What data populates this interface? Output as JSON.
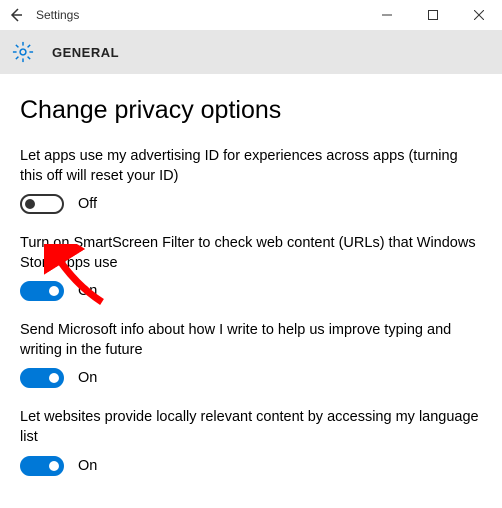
{
  "window": {
    "app_title": "Settings"
  },
  "category": {
    "label": "GENERAL"
  },
  "page": {
    "title": "Change privacy options"
  },
  "settings": [
    {
      "desc": "Let apps use my advertising ID for experiences across apps (turning this off will reset your ID)",
      "state": "off",
      "state_label": "Off"
    },
    {
      "desc": "Turn on SmartScreen Filter to check web content (URLs) that Windows Store apps use",
      "state": "on",
      "state_label": "On"
    },
    {
      "desc": "Send Microsoft info about how I write to help us improve typing and writing in the future",
      "state": "on",
      "state_label": "On"
    },
    {
      "desc": "Let websites provide locally relevant content by accessing my language list",
      "state": "on",
      "state_label": "On"
    }
  ],
  "annotation": {
    "arrow_target": "advertising-id-toggle",
    "color": "#ff0000"
  }
}
